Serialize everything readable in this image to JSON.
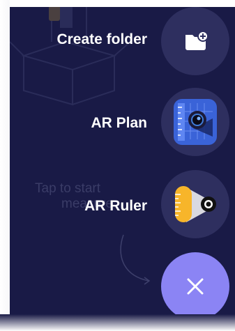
{
  "hint": {
    "line1": "Tap to start",
    "line2": "measure"
  },
  "actions": [
    {
      "label": "Create folder",
      "icon": "folder-add-icon"
    },
    {
      "label": "AR Plan",
      "icon": "ar-plan-app-icon"
    },
    {
      "label": "AR Ruler",
      "icon": "ar-ruler-app-icon"
    }
  ],
  "close_button": {
    "icon": "close-icon"
  },
  "colors": {
    "background": "#191a46",
    "fab": "#2e2f5f",
    "close_fab": "#8b84f4",
    "label": "#ffffff",
    "hint": "#3a3c67"
  }
}
